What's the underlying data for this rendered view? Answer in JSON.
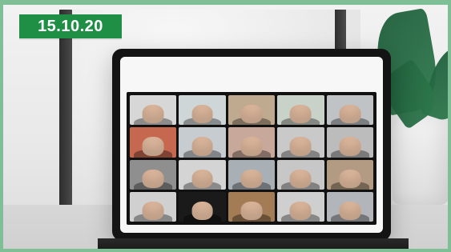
{
  "badge": {
    "date": "15.10.20",
    "color": "#1f8f45"
  },
  "scene": {
    "frame_border_color": "#7fbf95",
    "laptop_color": "#141414"
  },
  "video_call": {
    "tiles": [
      {
        "bg": "#d7d7d7"
      },
      {
        "bg": "#cfd6d8"
      },
      {
        "bg": "#bfa98f"
      },
      {
        "bg": "#c9d2c9"
      },
      {
        "bg": "#bfc3c6"
      },
      {
        "bg": "#c5684f"
      },
      {
        "bg": "#c7ccd0"
      },
      {
        "bg": "#c8a89a"
      },
      {
        "bg": "#c9c9c9"
      },
      {
        "bg": "#bcbcbc"
      },
      {
        "bg": "#8f8f8f"
      },
      {
        "bg": "#d4d4d4"
      },
      {
        "bg": "#a8b0b6"
      },
      {
        "bg": "#c7c7c7"
      },
      {
        "bg": "#b39a82"
      },
      {
        "bg": "#d0d0d0"
      },
      {
        "bg": "#1a1a1a"
      },
      {
        "bg": "#a37c55"
      },
      {
        "bg": "#cfcfcf"
      },
      {
        "bg": "#b2b6ba"
      }
    ]
  }
}
